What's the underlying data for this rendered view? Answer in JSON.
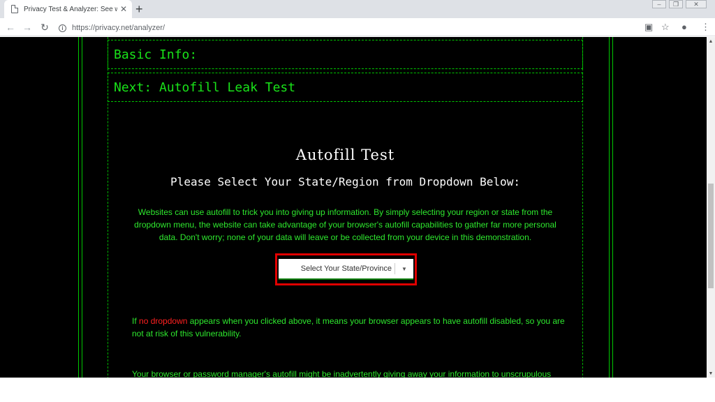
{
  "browser": {
    "tab_title": "Privacy Test & Analyzer: See wha",
    "url": "https://privacy.net/analyzer/"
  },
  "page": {
    "section_basic": "Basic Info:",
    "section_next": "Next: Autofill Leak Test",
    "title": "Autofill Test",
    "subtitle": "Please Select Your State/Region from Dropdown Below:",
    "description": "Websites can use autofill to trick you into giving up information. By simply selecting your region or state from the dropdown menu, the website can take advantage of your browser's autofill capabilities to gather far more personal data. Don't worry; none of your data will leave or be collected from your device in this demonstration.",
    "select_placeholder": "Select Your State/Province",
    "note_prefix": "If ",
    "note_highlight": "no dropdown",
    "note_suffix": " appears when you clicked above, it means your browser appears to have autofill disabled, so you are not at risk of this vulnerability.",
    "note2": "Your browser or password manager's autofill might be inadvertently giving away your information to unscrupulous"
  },
  "colors": {
    "page_bg": "#000000",
    "accent_green": "#19e319",
    "highlight_red": "#e00000",
    "warning_red": "#ff2020"
  },
  "icons": {
    "tab_favicon": "page-icon",
    "tab_close": "close-icon",
    "new_tab": "plus-icon",
    "back": "arrow-left-icon",
    "forward": "arrow-right-icon",
    "reload": "reload-icon",
    "site_info": "info-icon",
    "cast": "cast-icon",
    "bookmark": "star-icon",
    "account": "account-icon",
    "menu": "kebab-menu-icon",
    "dropdown": "caret-down-icon"
  }
}
